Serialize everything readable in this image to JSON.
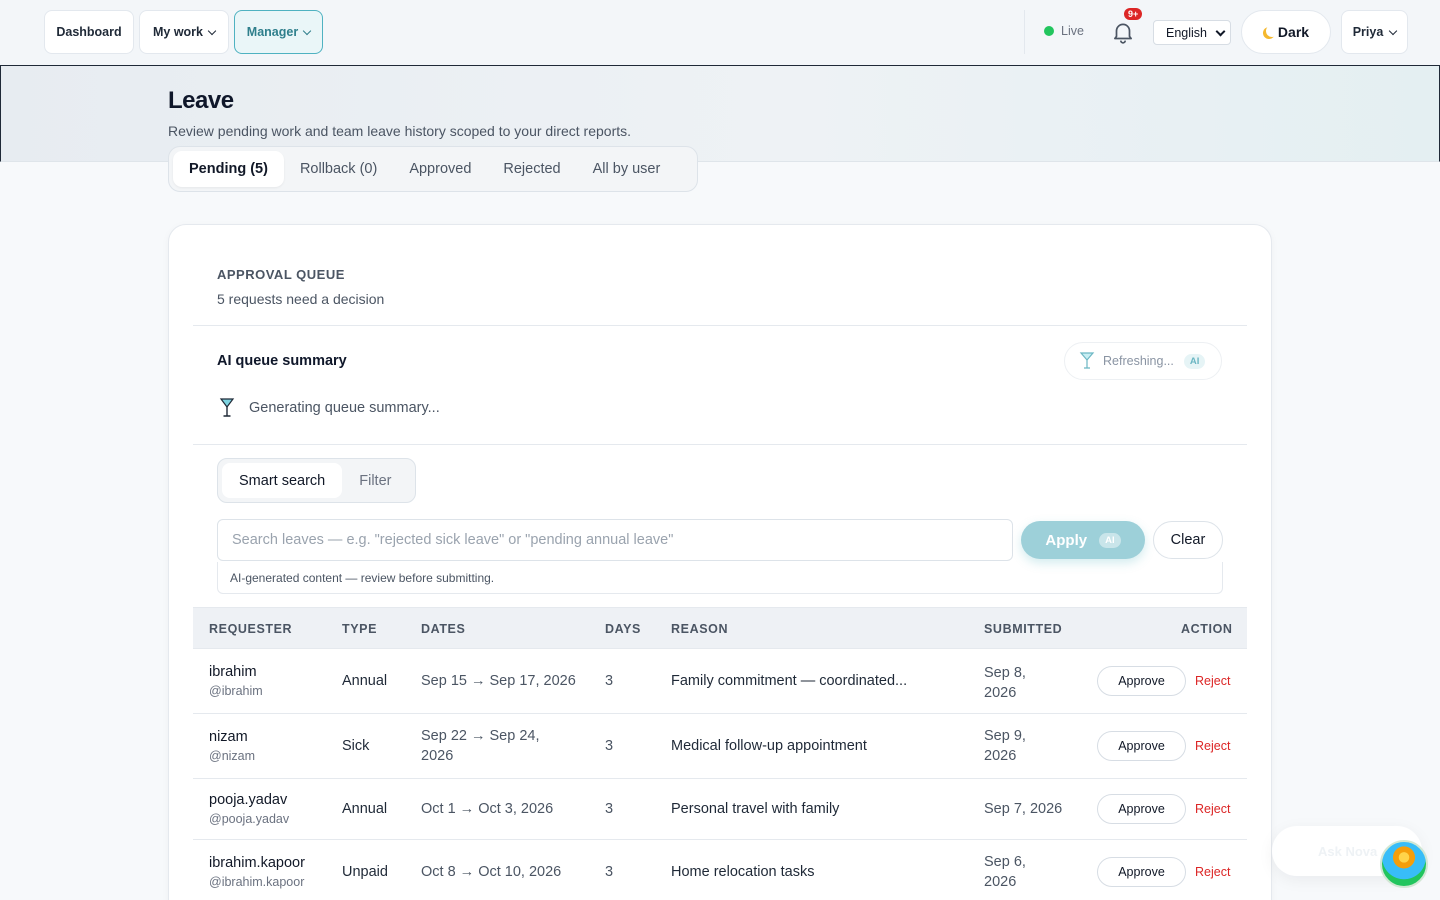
{
  "nav": {
    "dashboard": "Dashboard",
    "my_work": "My work",
    "manager": "Manager",
    "live": "Live",
    "notif_badge": "9+",
    "language": "English",
    "theme": "Dark",
    "user": "Priya"
  },
  "page": {
    "title": "Leave",
    "subtitle": "Review pending work and team leave history scoped to your direct reports."
  },
  "tabs": [
    {
      "label": "Pending (5)",
      "active": true
    },
    {
      "label": "Rollback (0)"
    },
    {
      "label": "Approved"
    },
    {
      "label": "Rejected"
    },
    {
      "label": "All by user"
    }
  ],
  "queue": {
    "heading": "APPROVAL QUEUE",
    "subheading": "5 requests need a decision"
  },
  "ai_summary": {
    "title": "AI queue summary",
    "refresh_label": "Refreshing...",
    "ai_badge": "AI",
    "generating": "Generating queue summary..."
  },
  "search": {
    "tabs": [
      "Smart search",
      "Filter"
    ],
    "placeholder": "Search leaves — e.g. \"rejected sick leave\" or \"pending annual leave\"",
    "value": "",
    "apply": "Apply",
    "ai_badge": "AI",
    "clear": "Clear",
    "disclaimer": "AI-generated content — review before submitting."
  },
  "table": {
    "columns": [
      "REQUESTER",
      "TYPE",
      "DATES",
      "DAYS",
      "REASON",
      "SUBMITTED",
      "ACTION"
    ],
    "approve_label": "Approve",
    "reject_label": "Reject",
    "rows": [
      {
        "name": "ibrahim",
        "handle": "@ibrahim",
        "type": "Annual",
        "dates": "Sep 15 → Sep 17, 2026",
        "days": "3",
        "reason": "Family commitment — coordinated...",
        "submitted": "Sep 8, 2026"
      },
      {
        "name": "nizam",
        "handle": "@nizam",
        "type": "Sick",
        "dates": "Sep 22 → Sep 24, 2026",
        "days": "3",
        "reason": "Medical follow-up appointment",
        "submitted": "Sep 9, 2026"
      },
      {
        "name": "pooja.yadav",
        "handle": "@pooja.yadav",
        "type": "Annual",
        "dates": "Oct 1 → Oct 3, 2026",
        "days": "3",
        "reason": "Personal travel with family",
        "submitted": "Sep 7, 2026"
      },
      {
        "name": "ibrahim.kapoor",
        "handle": "@ibrahim.kapoor",
        "type": "Unpaid",
        "dates": "Oct 8 → Oct 10, 2026",
        "days": "3",
        "reason": "Home relocation tasks",
        "submitted": "Sep 6, 2026"
      }
    ]
  },
  "assistant": {
    "label": "Ask Nova"
  },
  "colors": {
    "accent": "#4fb2c1",
    "reject": "#dc2626",
    "live": "#22c55e"
  }
}
